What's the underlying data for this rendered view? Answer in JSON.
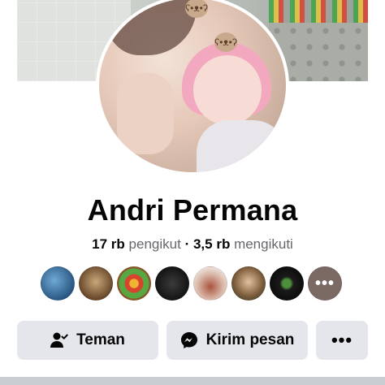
{
  "profile": {
    "name": "Andri Permana",
    "stats": {
      "followers_count": "17 rb",
      "followers_label": "pengikut",
      "separator": "·",
      "following_count": "3,5 rb",
      "following_label": "mengikuti"
    }
  },
  "friends_preview": {
    "count_visible": 7,
    "more_glyph": "•••"
  },
  "actions": {
    "friends_button": {
      "label": "Teman",
      "icon": "friend-check-icon"
    },
    "message_button": {
      "label": "Kirim pesan",
      "icon": "messenger-icon"
    },
    "more_button": {
      "label": "•••",
      "icon": "more-dots-icon"
    }
  },
  "colors": {
    "button_bg": "#e4e6eb",
    "text_primary": "#050505",
    "text_secondary": "#65676b",
    "divider": "#c9ccd1"
  }
}
